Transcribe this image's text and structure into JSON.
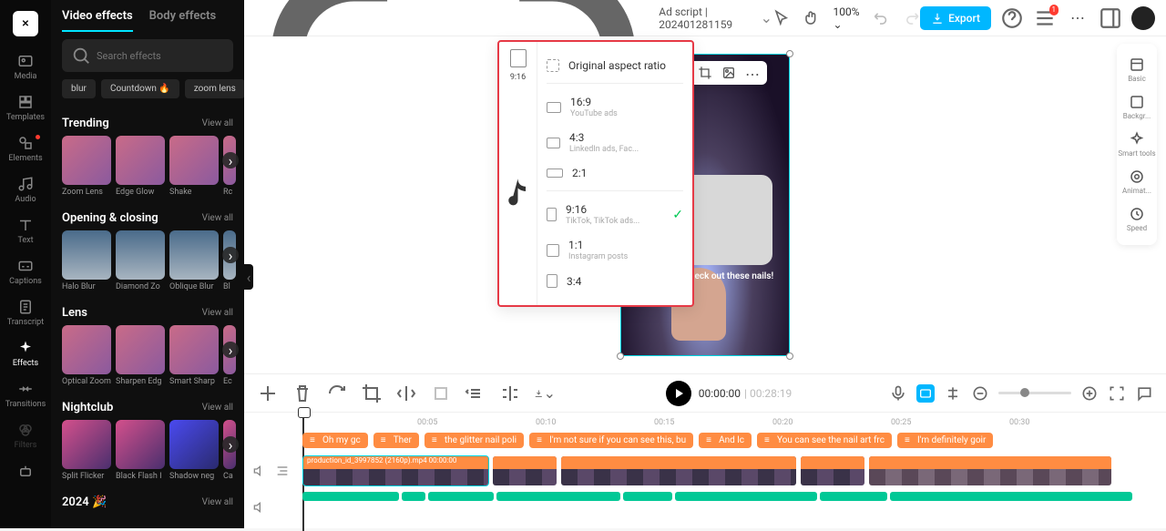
{
  "rail": {
    "items": [
      "Media",
      "Templates",
      "Elements",
      "Audio",
      "Text",
      "Captions",
      "Transcript",
      "Effects",
      "Transitions",
      "Filters"
    ]
  },
  "panel": {
    "tabs": {
      "video": "Video effects",
      "body": "Body effects"
    },
    "search_placeholder": "Search effects",
    "chips": [
      "blur",
      "Countdown 🔥",
      "zoom lens"
    ],
    "view_all": "View all",
    "sections": {
      "trending": {
        "title": "Trending",
        "items": [
          "Zoom Lens",
          "Edge Glow",
          "Shake",
          "Rc"
        ]
      },
      "opening": {
        "title": "Opening & closing",
        "items": [
          "Halo Blur",
          "Diamond Zo",
          "Oblique Blur",
          "Bl"
        ]
      },
      "lens": {
        "title": "Lens",
        "items": [
          "Optical Zoom",
          "Sharpen Edg",
          "Smart Sharp",
          "Ec"
        ]
      },
      "nightclub": {
        "title": "Nightclub",
        "items": [
          "Split Flicker",
          "Black Flash I",
          "Shadow neg",
          "Ca"
        ]
      },
      "year": {
        "title": "2024 🎉"
      }
    }
  },
  "topbar": {
    "project": "Ad script | 202401281159",
    "zoom": "100%",
    "export": "Export",
    "notif_count": "1"
  },
  "aspect": {
    "sidebar_label": "9:16",
    "original": "Original aspect ratio",
    "options": [
      {
        "label": "16:9",
        "sub": "YouTube ads"
      },
      {
        "label": "4:3",
        "sub": "LinkedIn ads, Fac..."
      },
      {
        "label": "2:1",
        "sub": ""
      },
      {
        "label": "9:16",
        "sub": "TikTok, TikTok ads...",
        "selected": true
      },
      {
        "label": "1:1",
        "sub": "Instagram posts"
      },
      {
        "label": "3:4",
        "sub": ""
      }
    ]
  },
  "preview": {
    "caption": "Oh my god, check out these nails!"
  },
  "props": {
    "items": [
      "Basic",
      "Backgr...",
      "Smart tools",
      "Animat...",
      "Speed"
    ]
  },
  "timeline": {
    "current": "00:00:00",
    "duration": "00:28:19",
    "ticks": [
      "00:05",
      "00:10",
      "00:15",
      "00:20",
      "00:25",
      "00:30"
    ],
    "subtitles": [
      "Oh my gc",
      "Ther",
      "the glitter nail poli",
      "I'm not sure if you can see this, bu",
      "And lc",
      "You can see the nail art frc",
      "I'm definitely goir"
    ],
    "video_label": "production_id_3997852 (2160p).mp4  00:00:00",
    "vclips": [
      205,
      72,
      260,
      72,
      268
    ],
    "aclips": [
      106,
      26,
      72,
      136,
      54,
      156,
      74,
      266
    ]
  }
}
